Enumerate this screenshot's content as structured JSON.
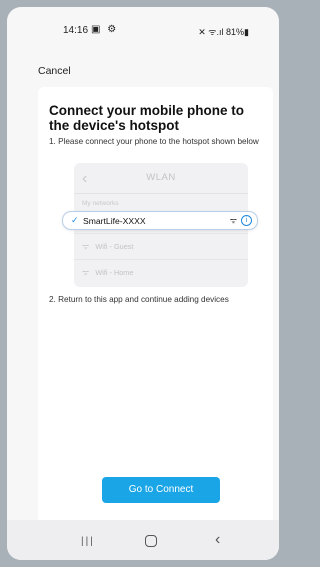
{
  "status": {
    "time": "14:16",
    "left_icons": "▣ ⚙",
    "right_text": "✕ ᯤ.ıl 81%▮"
  },
  "header": {
    "cancel_label": "Cancel"
  },
  "main": {
    "title": "Connect your mobile phone to the device's hotspot",
    "step1": "1. Please connect your phone to the hotspot shown below",
    "step2": "2. Return to this app and continue adding devices",
    "connect_button": "Go to Connect"
  },
  "wlan": {
    "back_glyph": "‹",
    "title": "WLAN",
    "section_label": "My networks",
    "selected_network": "SmartLife-XXXX",
    "other_networks": [
      "Wifi - Guest",
      "Wifi - Home"
    ],
    "check_icon": "check-icon",
    "info_glyph": "i"
  },
  "navbar": {
    "recents_glyph": "|||",
    "back_glyph": "‹"
  },
  "colors": {
    "accent": "#1aa5e6",
    "background": "#a9b1b8",
    "highlight_border": "#b9cfe8"
  }
}
